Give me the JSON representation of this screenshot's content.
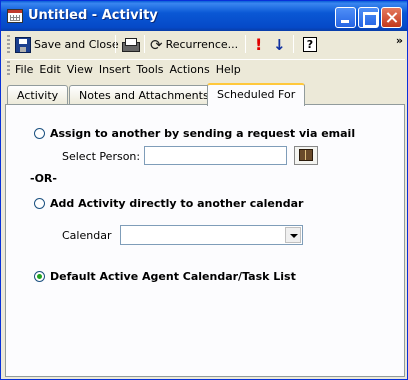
{
  "window": {
    "title": "Untitled - Activity"
  },
  "toolbar": {
    "save_close_label": "Save and Close",
    "recurrence_label": "Recurrence...",
    "importance_glyph": "!",
    "low_priority_glyph": "↓",
    "help_glyph": "?",
    "more_glyph": "»",
    "recur_glyph": "⟳"
  },
  "menu": {
    "items": [
      "File",
      "Edit",
      "View",
      "Insert",
      "Tools",
      "Actions",
      "Help"
    ]
  },
  "tabs": [
    {
      "label": "Activity"
    },
    {
      "label": "Notes and Attachments"
    },
    {
      "label": "Scheduled For",
      "active": true
    }
  ],
  "form": {
    "option_email_label": "Assign to another by sending a request via email",
    "select_person_label": "Select Person:",
    "select_person_value": "",
    "or_label": "-OR-",
    "option_calendar_label": "Add Activity directly to another calendar",
    "calendar_label": "Calendar",
    "calendar_value": "",
    "option_default_label": "Default Active Agent Calendar/Task List",
    "selected_option": "default"
  },
  "colors": {
    "titlebar": "#0a58d5",
    "accent_tab": "#ffc83c",
    "radio_dot": "#21a121"
  }
}
